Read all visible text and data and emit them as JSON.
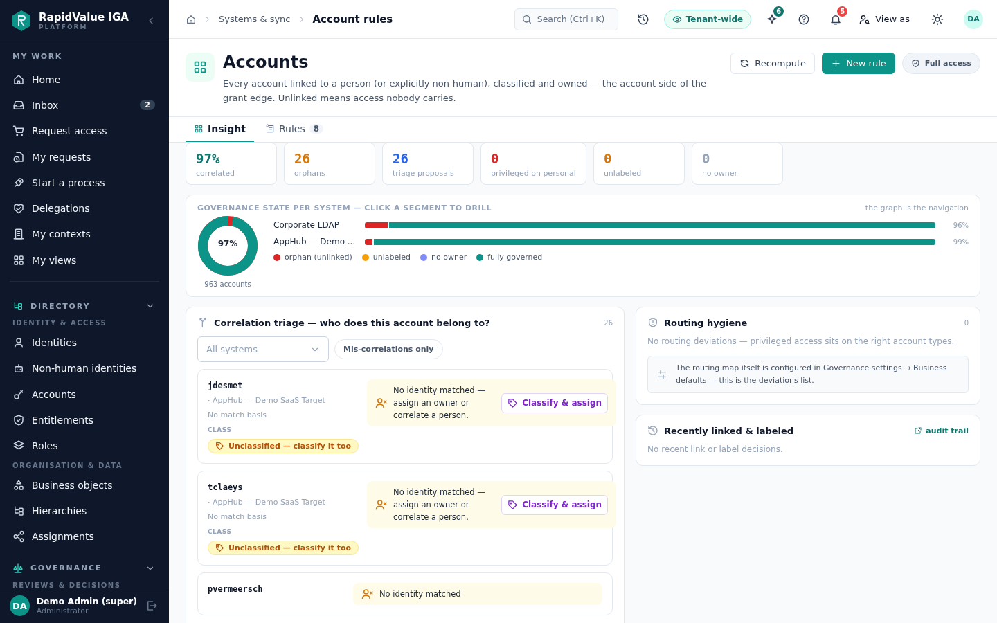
{
  "sidebar": {
    "brand": {
      "name": "RapidValue IGA",
      "sub": "PLATFORM"
    },
    "nav": [
      {
        "kind": "section",
        "label": "MY WORK"
      },
      {
        "kind": "item",
        "label": "Home"
      },
      {
        "kind": "item",
        "label": "Inbox",
        "badge": "2"
      },
      {
        "kind": "item",
        "label": "Request access"
      },
      {
        "kind": "item",
        "label": "My requests"
      },
      {
        "kind": "item",
        "label": "Start a process"
      },
      {
        "kind": "item",
        "label": "Delegations"
      },
      {
        "kind": "item",
        "label": "My contexts"
      },
      {
        "kind": "item",
        "label": "My views"
      },
      {
        "kind": "group",
        "label": "DIRECTORY",
        "expanded": true
      },
      {
        "kind": "subsection",
        "label": "IDENTITY & ACCESS"
      },
      {
        "kind": "item",
        "label": "Identities"
      },
      {
        "kind": "item",
        "label": "Non-human identities"
      },
      {
        "kind": "item",
        "label": "Accounts"
      },
      {
        "kind": "item",
        "label": "Entitlements"
      },
      {
        "kind": "item",
        "label": "Roles"
      },
      {
        "kind": "subsection",
        "label": "ORGANISATION & DATA"
      },
      {
        "kind": "item",
        "label": "Business objects"
      },
      {
        "kind": "item",
        "label": "Hierarchies"
      },
      {
        "kind": "item",
        "label": "Assignments"
      },
      {
        "kind": "group",
        "label": "GOVERNANCE",
        "expanded": true
      },
      {
        "kind": "subsection",
        "label": "REVIEWS & DECISIONS"
      }
    ],
    "user": {
      "initials": "DA",
      "name": "Demo Admin (super)",
      "role": "Administrator"
    }
  },
  "topbar": {
    "breadcrumb": [
      "Systems & sync",
      "Account rules"
    ],
    "search": {
      "placeholder": "Search (Ctrl+K)"
    },
    "scope": "Tenant-wide",
    "sparkle_badge": "6",
    "bell_badge": "5",
    "view_as": "View as",
    "avatar": "DA"
  },
  "header": {
    "title": "Accounts",
    "description": "Every account linked to a person (or explicitly non-human), classified and owned — the account side of the grant edge. Unlinked means access nobody carries.",
    "buttons": [
      {
        "kind": "outline",
        "label": "Recompute"
      },
      {
        "kind": "primary",
        "label": "New rule"
      },
      {
        "kind": "pill",
        "label": "Full access"
      }
    ]
  },
  "tabs": [
    {
      "label": "Insight",
      "selected": true
    },
    {
      "label": "Rules",
      "count": "8",
      "selected": false
    }
  ],
  "stats": [
    {
      "value": "97%",
      "label": "correlated",
      "color": "#0f766e"
    },
    {
      "value": "26",
      "label": "orphans",
      "color": "#d97706"
    },
    {
      "value": "26",
      "label": "triage proposals",
      "color": "#2563eb"
    },
    {
      "value": "0",
      "label": "privileged on personal",
      "color": "#dc2626"
    },
    {
      "value": "0",
      "label": "unlabeled",
      "color": "#d97706"
    },
    {
      "value": "0",
      "label": "no owner",
      "color": "#94a3b8"
    }
  ],
  "governance": {
    "title": "GOVERNANCE STATE PER SYSTEM — CLICK A SEGMENT TO DRILL",
    "note": "the graph is the navigation",
    "donut": {
      "label": "97%",
      "level": 0.97,
      "caption": "963 accounts"
    },
    "systems": [
      {
        "name": "Corporate LDAP",
        "percent": "96%",
        "segments": [
          {
            "level": 0.04,
            "color": "#dc2626"
          },
          {
            "level": 0.96,
            "color": "#0d9488"
          }
        ]
      },
      {
        "name": "AppHub — Demo ...",
        "percent": "99%",
        "segments": [
          {
            "level": 0.013,
            "color": "#dc2626"
          },
          {
            "level": 0.987,
            "color": "#0d9488"
          }
        ]
      }
    ],
    "legend": [
      {
        "label": "orphan (unlinked)",
        "color": "#dc2626"
      },
      {
        "label": "unlabeled",
        "color": "#f59e0b"
      },
      {
        "label": "no owner",
        "color": "#818cf8"
      },
      {
        "label": "fully governed",
        "color": "#0d9488"
      }
    ]
  },
  "triage": {
    "title": "Correlation triage — who does this account belong to?",
    "count": "26",
    "filter": {
      "value": "All systems"
    },
    "toggle": "Mis-correlations only",
    "items": [
      {
        "account": "jdesmet",
        "source": "· AppHub — Demo SaaS Target",
        "basis": "No match basis",
        "class_label": "CLASS",
        "class": "Unclassified — classify it too",
        "notice": "No identity matched — assign an owner or correlate a person.",
        "action": "Classify & assign"
      },
      {
        "account": "tclaeys",
        "source": "· AppHub — Demo SaaS Target",
        "basis": "No match basis",
        "class_label": "CLASS",
        "class": "Unclassified — classify it too",
        "notice": "No identity matched — assign an owner or correlate a person.",
        "action": "Classify & assign"
      },
      {
        "account": "pvermeersch",
        "notice": "No identity matched"
      }
    ]
  },
  "routing": {
    "title": "Routing hygiene",
    "count": "0",
    "message": "No routing deviations — privileged access sits on the right account types.",
    "info": "The routing map itself is configured in Governance settings → Business defaults — this is the deviations list."
  },
  "recent": {
    "title": "Recently linked & labeled",
    "link": "audit trail",
    "message": "No recent link or label decisions."
  }
}
